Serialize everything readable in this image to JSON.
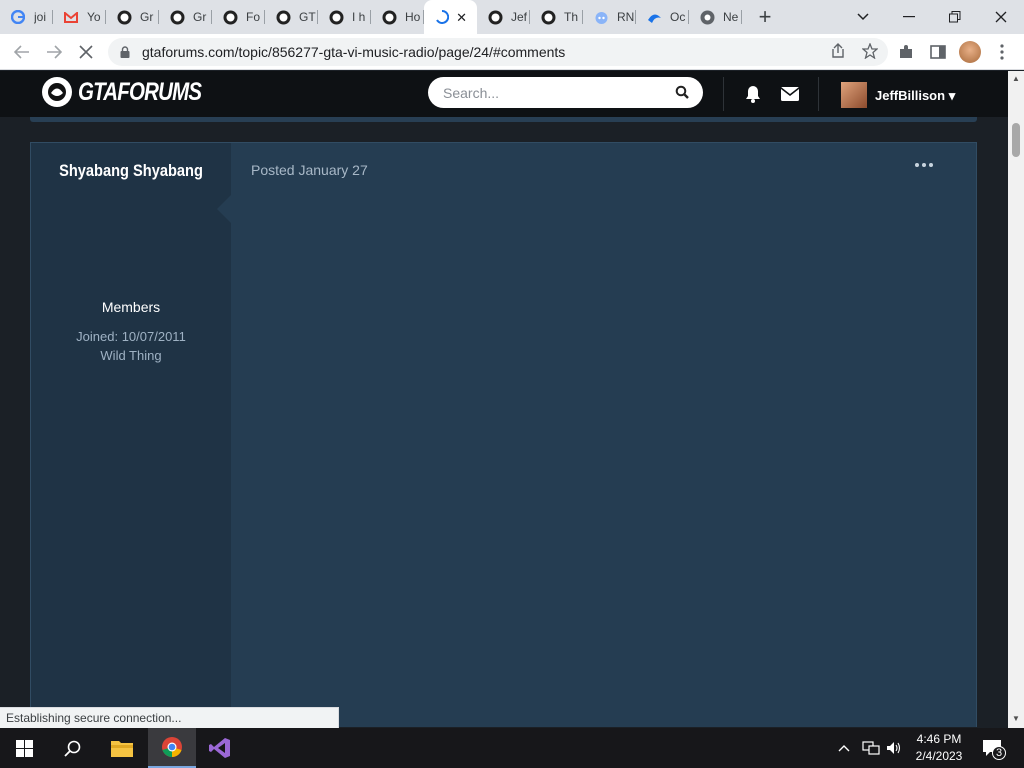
{
  "browser": {
    "tabs": [
      {
        "title": "joi",
        "icon": "google-icon"
      },
      {
        "title": "Yo",
        "icon": "gmail-icon"
      },
      {
        "title": "Gr",
        "icon": "gtaforums-icon"
      },
      {
        "title": "Gr",
        "icon": "gtaforums-icon"
      },
      {
        "title": "Fo",
        "icon": "gtaforums-icon"
      },
      {
        "title": "GT",
        "icon": "gtaforums-icon"
      },
      {
        "title": "I h",
        "icon": "gtaforums-icon"
      },
      {
        "title": "Ho",
        "icon": "gtaforums-icon"
      },
      {
        "title": "",
        "icon": "loading-spinner-icon",
        "active": true
      },
      {
        "title": "Jef",
        "icon": "gtaforums-icon"
      },
      {
        "title": "Th",
        "icon": "gtaforums-icon"
      },
      {
        "title": "RN",
        "icon": "reddit-icon"
      },
      {
        "title": "Oc",
        "icon": "edge-icon"
      },
      {
        "title": "Ne",
        "icon": "chrome-icon"
      }
    ],
    "url": "gtaforums.com/topic/856277-gta-vi-music-radio/page/24/#comments",
    "status_text": "Establishing secure connection..."
  },
  "site": {
    "logo_text": "GTAFORUMS",
    "search_placeholder": "Search...",
    "username": "JeffBillison"
  },
  "post": {
    "author_name": "Shyabang Shyabang",
    "group": "Members",
    "joined": "Joined: 10/07/2011",
    "title": "Wild Thing",
    "posted": "Posted January 27"
  },
  "taskbar": {
    "time": "4:46 PM",
    "date": "2/4/2023",
    "notification_count": "3"
  },
  "colors": {
    "post_bg": "#253d52",
    "author_bg": "#1f3345",
    "header_bg": "#0e1114"
  }
}
